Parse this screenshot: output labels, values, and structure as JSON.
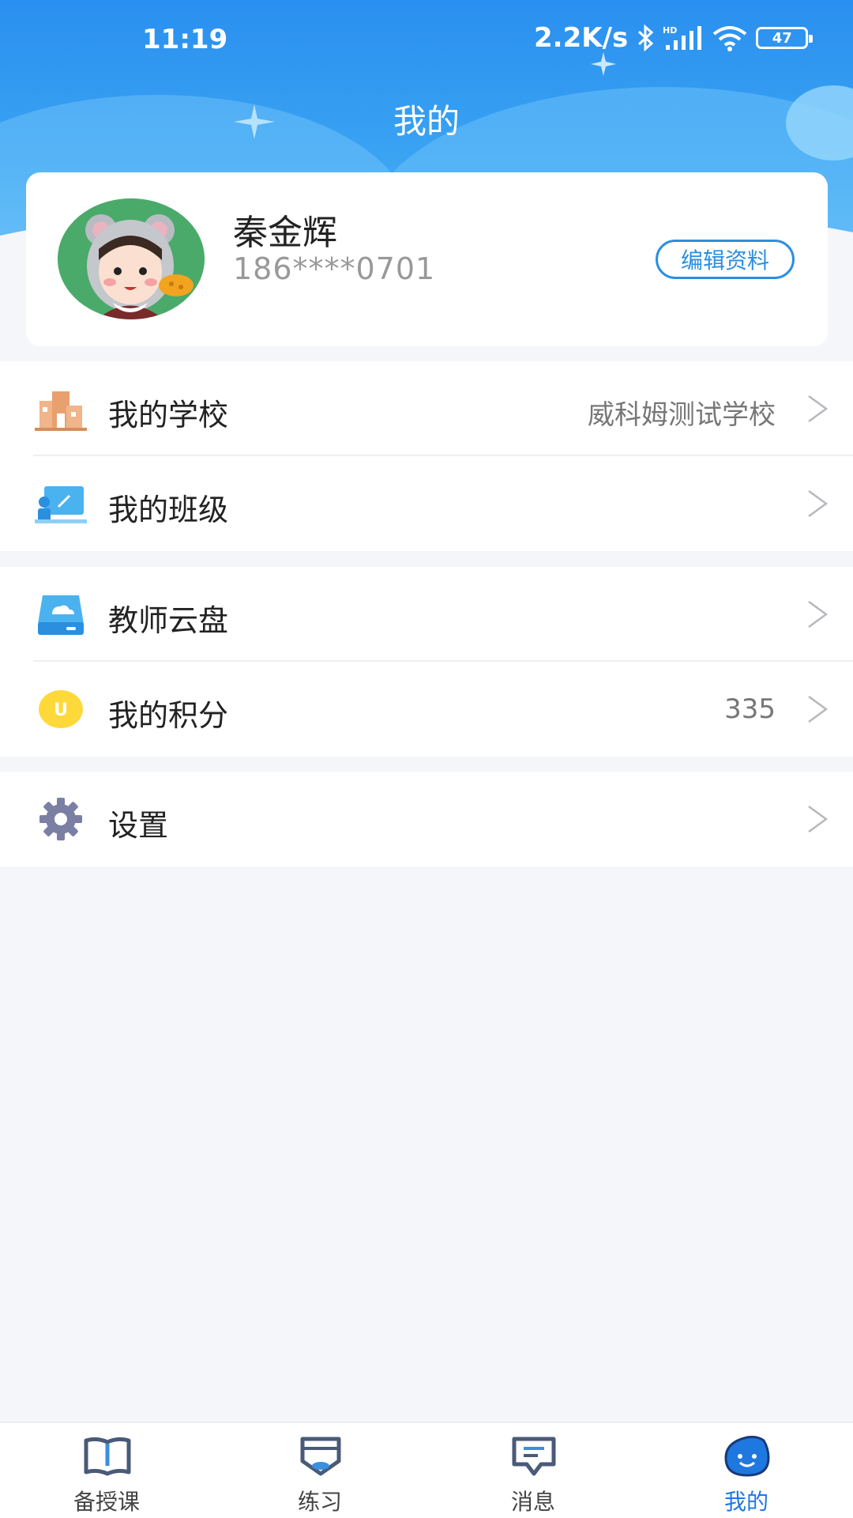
{
  "status": {
    "time": "11:19",
    "speed": "2.2K/s",
    "hd": "HD",
    "battery": "47"
  },
  "page": {
    "title": "我的"
  },
  "profile": {
    "name": "秦金辉",
    "phone": "186****0701",
    "edit_label": "编辑资料"
  },
  "menu": {
    "school": {
      "label": "我的学校",
      "value": "威科姆测试学校",
      "icon": "school-building-icon"
    },
    "class": {
      "label": "我的班级",
      "icon": "classroom-icon"
    },
    "cloud": {
      "label": "教师云盘",
      "icon": "cloud-drive-icon"
    },
    "points": {
      "label": "我的积分",
      "value": "335",
      "icon": "points-coin-icon",
      "badge": "U"
    },
    "settings": {
      "label": "设置",
      "icon": "gear-icon"
    }
  },
  "tabbar": {
    "tabs": [
      {
        "label": "备授课",
        "icon": "book-icon"
      },
      {
        "label": "练习",
        "icon": "practice-icon"
      },
      {
        "label": "消息",
        "icon": "message-icon"
      },
      {
        "label": "我的",
        "icon": "mascot-icon"
      }
    ],
    "active_index": 3
  },
  "colors": {
    "accent": "#2b8fe0",
    "header_blue": "#2a8ff0",
    "active_tab": "#1f78e0",
    "background": "#f4f6fa"
  }
}
